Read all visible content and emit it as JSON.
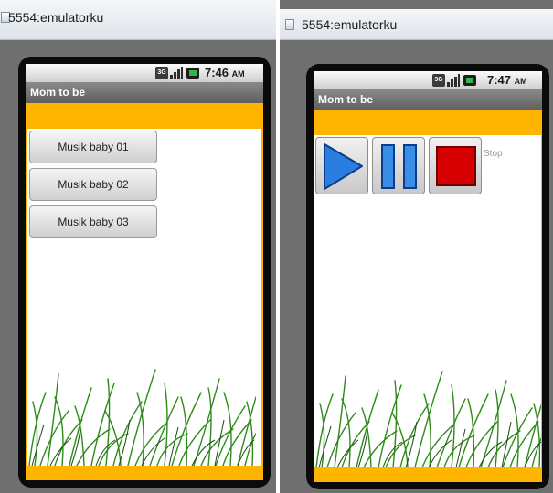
{
  "left_window": {
    "title": "5554:emulatorku",
    "status": {
      "network": "3G",
      "time": "7:46",
      "ampm": "AM"
    },
    "app_title": "Mom to be",
    "buttons": [
      {
        "label": "Musik baby 01"
      },
      {
        "label": "Musik baby 02"
      },
      {
        "label": "Musik baby 03"
      }
    ]
  },
  "right_window": {
    "title": "5554:emulatorku",
    "status": {
      "network": "3G",
      "time": "7:47",
      "ampm": "AM"
    },
    "app_title": "Mom to be",
    "controls": {
      "play_icon": "play-icon",
      "pause_icon": "pause-icon",
      "stop_icon": "stop-icon"
    },
    "stop_label": "Stop"
  },
  "colors": {
    "app_accent": "#ffb400",
    "play_blue": "#2a7de1",
    "stop_red": "#d60000",
    "grass_green": "#2e8b1a"
  }
}
